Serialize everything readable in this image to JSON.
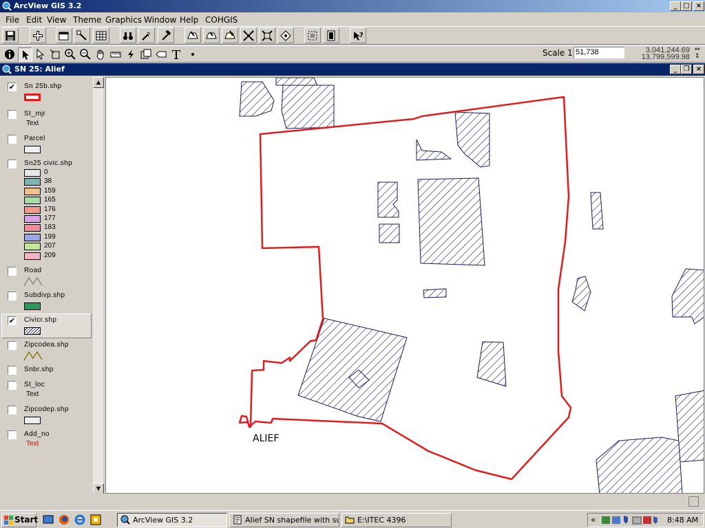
{
  "app": {
    "title": "ArcView GIS 3.2",
    "title_buttons": [
      "minimize",
      "maximize",
      "close"
    ]
  },
  "menu": [
    "File",
    "Edit",
    "View",
    "Theme",
    "Graphics",
    "Window",
    "Help",
    "COHGIS"
  ],
  "toolbar": {
    "buttons": [
      "save",
      "add-theme",
      "theme-properties",
      "edit-legend",
      "open-attribute-table",
      "find",
      "query-builder",
      "locate",
      "zoom-full",
      "zoom-to-themes",
      "zoom-to-selected",
      "zoom-in",
      "zoom-out",
      "zoom-previous",
      "select-by-theme",
      "clear-selection",
      "help"
    ]
  },
  "tools": [
    "identify",
    "pointer",
    "vertex-edit",
    "select-feature",
    "zoom-in",
    "zoom-out",
    "pan",
    "measure",
    "hotlink",
    "area-of-interest",
    "label",
    "text",
    "draw"
  ],
  "scale": {
    "label": "Scale 1:",
    "value": "51,738"
  },
  "coords": {
    "x": "3,041,244.69",
    "y": "13,799,599.98"
  },
  "view": {
    "title": "SN 25: Alief"
  },
  "legend": [
    {
      "name": "Sn 25b.shp",
      "checked": true,
      "swatch": "red-outline"
    },
    {
      "name": "St_mjr",
      "checked": false,
      "text": "Text"
    },
    {
      "name": "Parcel",
      "checked": false,
      "swatch": "plain"
    },
    {
      "name": "Sn25 civic.shp",
      "checked": false,
      "classes": [
        {
          "label": "0",
          "color": "#e8e8e8"
        },
        {
          "label": "38",
          "color": "#7fb3b3"
        },
        {
          "label": "159",
          "color": "#f2c08a"
        },
        {
          "label": "165",
          "color": "#a6dca6"
        },
        {
          "label": "176",
          "color": "#f29a8a"
        },
        {
          "label": "177",
          "color": "#d8a6e6"
        },
        {
          "label": "183",
          "color": "#f28a9a"
        },
        {
          "label": "199",
          "color": "#9aa6e6"
        },
        {
          "label": "207",
          "color": "#c6e69a"
        },
        {
          "label": "209",
          "color": "#f2b3c6"
        }
      ]
    },
    {
      "name": "Road",
      "checked": false,
      "swatch": "line-grey"
    },
    {
      "name": "Subdivp.shp",
      "checked": false,
      "swatch": "green"
    },
    {
      "name": "Civicr.shp",
      "checked": true,
      "swatch": "hatch",
      "active": true
    },
    {
      "name": "Zipcodea.shp",
      "checked": false,
      "swatch": "line-olive"
    },
    {
      "name": "Snbr.shp",
      "checked": false
    },
    {
      "name": "St_loc",
      "checked": false,
      "text": "Text"
    },
    {
      "name": "Zipcodep.shp",
      "checked": false,
      "swatch": "plain"
    },
    {
      "name": "Add_no",
      "checked": false,
      "text": "Text",
      "text_color": "#cc0000"
    }
  ],
  "map": {
    "label": "ALIEF",
    "boundary_color": "#e31a1c",
    "hatch_color": "#1a1a5a"
  },
  "taskbar": {
    "start": "Start",
    "tasks": [
      "ArcView GIS 3.2",
      "Alief SN shapefile with su...",
      "E:\\ITEC 4396"
    ],
    "clock": "8:48 AM",
    "tray_expand": "«"
  }
}
